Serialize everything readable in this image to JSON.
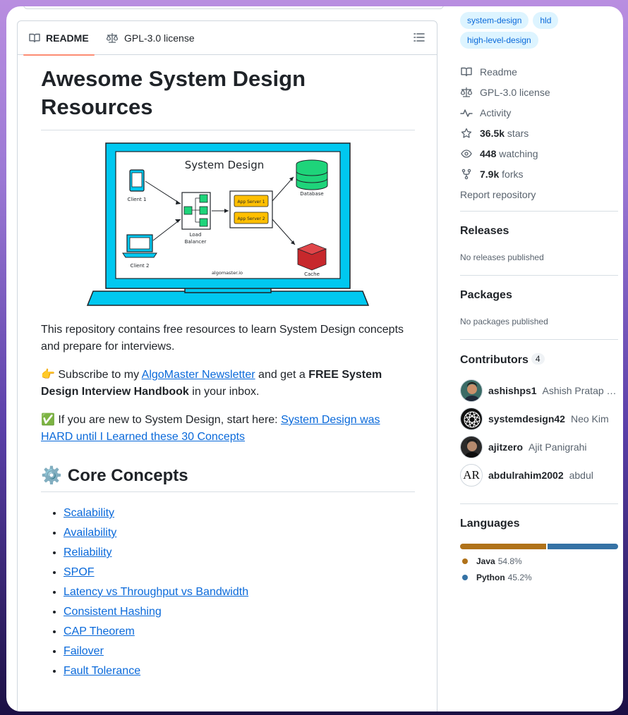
{
  "readme_tabs": {
    "readme": "README",
    "license": "GPL-3.0 license"
  },
  "readme": {
    "title": "Awesome System Design Resources",
    "diagram": {
      "heading": "System Design",
      "client1": "Client 1",
      "client2": "Client 2",
      "lb_line1": "Load",
      "lb_line2": "Balancer",
      "app1": "App Server 1",
      "app2": "App Server 2",
      "database": "Database",
      "cache": "Cache",
      "site": "algomaster.io"
    },
    "intro": "This repository contains free resources to learn System Design concepts and prepare for interviews.",
    "subscribe_emoji": "👉",
    "subscribe_pre": " Subscribe to my ",
    "subscribe_link": "AlgoMaster Newsletter",
    "subscribe_mid": " and get a ",
    "subscribe_bold": "FREE System Design Interview Handbook",
    "subscribe_post": " in your inbox.",
    "new_emoji": "✅",
    "new_pre": " If you are new to System Design, start here: ",
    "new_link": "System Design was HARD until I Learned these 30 Concepts",
    "section_icon": "⚙️",
    "section_title": "Core Concepts",
    "concepts": [
      "Scalability",
      "Availability",
      "Reliability",
      "SPOF",
      "Latency vs Throughput vs Bandwidth",
      "Consistent Hashing",
      "CAP Theorem",
      "Failover",
      "Fault Tolerance"
    ]
  },
  "sidebar": {
    "topics": [
      "system-design",
      "hld",
      "high-level-design"
    ],
    "meta": {
      "readme": "Readme",
      "license": "GPL-3.0 license",
      "activity": "Activity",
      "stars_count": "36.5k",
      "stars_label": " stars",
      "watching_count": "448",
      "watching_label": " watching",
      "forks_count": "7.9k",
      "forks_label": " forks",
      "report": "Report repository"
    },
    "releases": {
      "title": "Releases",
      "note": "No releases published"
    },
    "packages": {
      "title": "Packages",
      "note": "No packages published"
    },
    "contributors": {
      "title": "Contributors",
      "count": "4",
      "list": [
        {
          "login": "ashishps1",
          "name": "Ashish Pratap …"
        },
        {
          "login": "systemdesign42",
          "name": "Neo Kim"
        },
        {
          "login": "ajitzero",
          "name": "Ajit Panigrahi"
        },
        {
          "login": "abdulrahim2002",
          "name": "abdul"
        }
      ],
      "avatar_text_4": "AR"
    },
    "languages": {
      "title": "Languages",
      "items": [
        {
          "name": "Java",
          "percent": "54.8%",
          "value": 54.8,
          "color": "#b07219"
        },
        {
          "name": "Python",
          "percent": "45.2%",
          "value": 45.2,
          "color": "#3572A5"
        }
      ]
    }
  }
}
